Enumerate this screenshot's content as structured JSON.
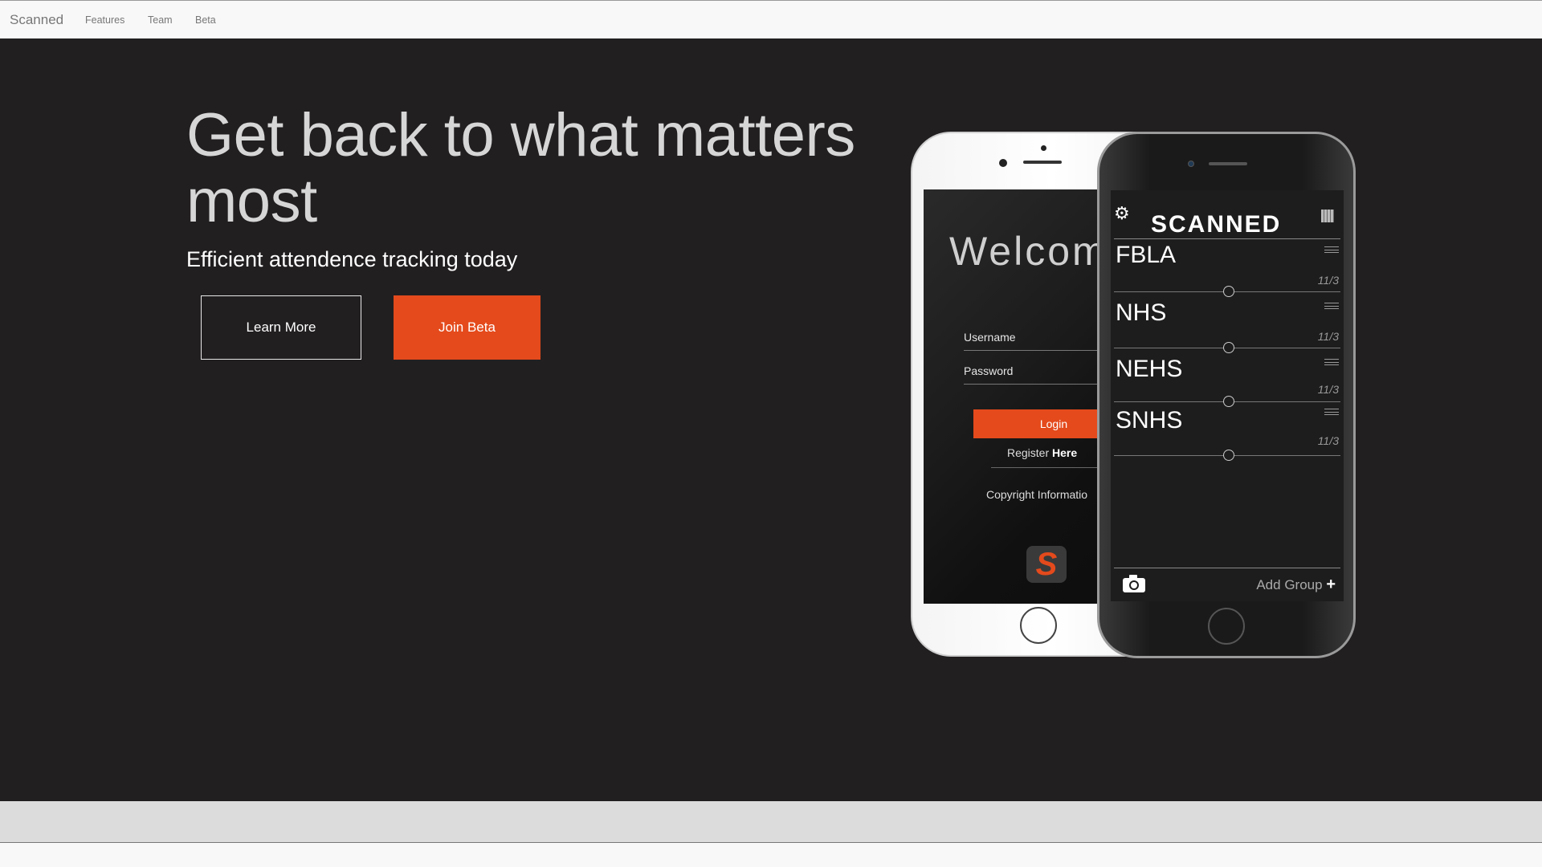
{
  "nav": {
    "brand": "Scanned",
    "links": [
      "Features",
      "Team",
      "Beta"
    ]
  },
  "hero": {
    "headline": "Get back to what matters most",
    "subhead": "Efficient attendence tracking today",
    "learn_more_label": "Learn More",
    "join_beta_label": "Join Beta"
  },
  "login_phone": {
    "welcome": "Welcom",
    "username_label": "Username",
    "password_label": "Password",
    "login_label": "Login",
    "register_prefix": "Register ",
    "register_link": "Here",
    "copyright": "Copyright Informatio",
    "logo_letter": "S"
  },
  "app_phone": {
    "title": "SCANNED",
    "groups": [
      {
        "name": "FBLA",
        "date": "11/3"
      },
      {
        "name": "NHS",
        "date": "11/3"
      },
      {
        "name": "NEHS",
        "date": "11/3"
      },
      {
        "name": "SNHS",
        "date": "11/3"
      }
    ],
    "add_group_label": "Add Group",
    "add_symbol": "+"
  },
  "colors": {
    "accent": "#e44a1c",
    "hero_bg": "#221f20",
    "navbar_bg": "#f8f8f8"
  }
}
